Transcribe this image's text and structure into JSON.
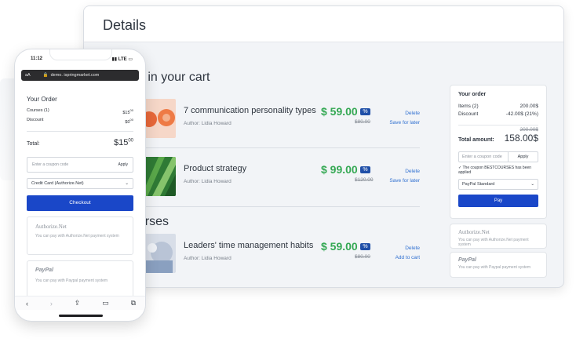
{
  "desktop": {
    "title": "Details",
    "cart_heading": "es in your cart",
    "courses_heading": "ourses",
    "items": [
      {
        "name": "7 communication personality types",
        "author": "Author: Lidia Howard",
        "price": "$ 59.00",
        "old_price": "$80.00",
        "action1": "Delete",
        "action2": "Save for later"
      },
      {
        "name": "Product strategy",
        "author": "Author: Lidia Howard",
        "price": "$ 99.00",
        "old_price": "$120.00",
        "action1": "Delete",
        "action2": "Save for later"
      },
      {
        "name": "Leaders' time management habits",
        "author": "Author: Lidia Howard",
        "price": "$ 59.00",
        "old_price": "$80.00",
        "action1": "Delete",
        "action2": "Add to cart"
      }
    ],
    "order": {
      "title": "Your order",
      "items_label": "Items (2)",
      "items_value": "200.00$",
      "discount_label": "Discount",
      "discount_value": "-42.00$ (21%)",
      "old_total": "200.00$",
      "total_label": "Total amount:",
      "total_value": "158.00$",
      "coupon_placeholder": "Enter a coupon code",
      "apply_label": "Apply",
      "coupon_applied": "✓ The coupon BESTCOURSES has been applied",
      "payment_method": "PayPal Standard",
      "pay_label": "Pay"
    },
    "pm_authorize": {
      "logo": "Authorize.Net",
      "text": "You can pay with Authorize.Net payment system"
    },
    "pm_paypal": {
      "logo": "PayPal",
      "text": "You can pay with Paypal payment system"
    }
  },
  "phone": {
    "time": "11:12",
    "signal": "LTE",
    "aa": "aA",
    "url": "demo. ispringmarket.com",
    "order_title": "Your Order",
    "courses_label": "Courses (1)",
    "courses_value": "$15",
    "courses_cents": "00",
    "discount_label": "Discount",
    "discount_value": "$0",
    "discount_cents": "00",
    "total_label": "Total:",
    "total_value": "$15",
    "total_cents": "00",
    "coupon_placeholder": "Enter a coupon code",
    "apply_label": "Apply",
    "payment_method": "Credit Card (Authorize.Net)",
    "checkout_label": "Checkout",
    "authorize": {
      "logo": "Authorize.Net",
      "text": "You can pay with Authorize.Net payment system"
    },
    "paypal": {
      "logo": "PayPal",
      "text": "You can pay with Paypal payment system"
    }
  },
  "colors": {
    "accent": "#1a47c8",
    "price_green": "#34a853",
    "link": "#2f6fd0"
  }
}
